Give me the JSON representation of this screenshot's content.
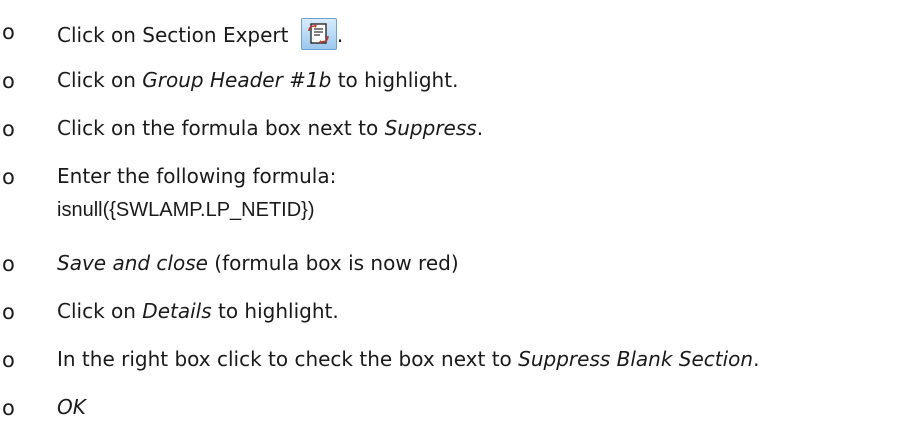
{
  "steps": [
    {
      "parts": [
        {
          "text": "Click on Section Expert ",
          "italic": false
        },
        {
          "icon": "section-expert-icon"
        },
        {
          "text": ".",
          "italic": false
        }
      ]
    },
    {
      "parts": [
        {
          "text": "Click on ",
          "italic": false
        },
        {
          "text": "Group Header #1b",
          "italic": true
        },
        {
          "text": " to highlight.",
          "italic": false
        }
      ]
    },
    {
      "parts": [
        {
          "text": "Click on the formula box next to ",
          "italic": false
        },
        {
          "text": "Suppress",
          "italic": true
        },
        {
          "text": ".",
          "italic": false
        }
      ]
    },
    {
      "parts": [
        {
          "text": "Enter the following formula:",
          "italic": false
        }
      ],
      "formula": "isnull({SWLAMP.LP_NETID})"
    },
    {
      "parts": [
        {
          "text": "Save and close",
          "italic": true
        },
        {
          "text": " (formula box is now red)",
          "italic": false
        }
      ]
    },
    {
      "parts": [
        {
          "text": "Click on ",
          "italic": false
        },
        {
          "text": "Details",
          "italic": true
        },
        {
          "text": " to highlight.",
          "italic": false
        }
      ]
    },
    {
      "parts": [
        {
          "text": "In the right box click to check the box next to ",
          "italic": false
        },
        {
          "text": "Suppress Blank Section",
          "italic": true
        },
        {
          "text": ".",
          "italic": false
        }
      ]
    },
    {
      "parts": [
        {
          "text": "OK",
          "italic": true
        }
      ]
    }
  ],
  "bullet_char": "o",
  "colors": {
    "text": "#1a1a1a",
    "icon_bg_top": "#d8ecfb",
    "icon_bg_bottom": "#9cc7ee",
    "icon_border": "#6ea1d4"
  }
}
